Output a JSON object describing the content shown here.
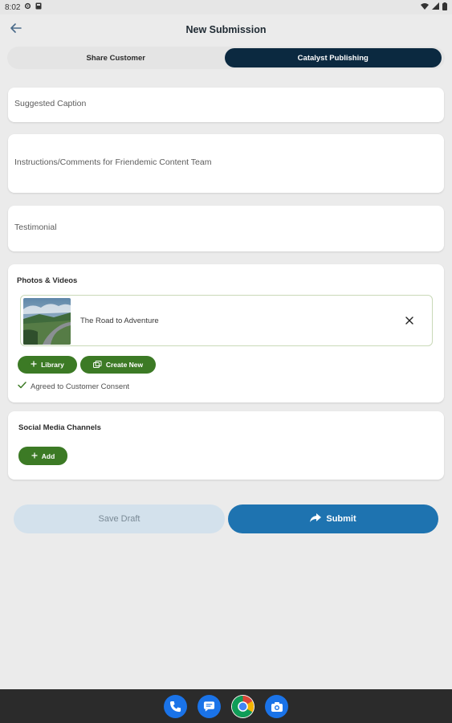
{
  "status_bar": {
    "time": "8:02",
    "icons": [
      "settings-icon",
      "notification-icon",
      "wifi-icon",
      "signal-icon",
      "battery-icon"
    ]
  },
  "app_bar": {
    "title": "New Submission",
    "back_icon": "arrow-left-icon"
  },
  "tabs": [
    {
      "label": "Share Customer",
      "active": false
    },
    {
      "label": "Catalyst Publishing",
      "active": true
    }
  ],
  "fields": {
    "caption_placeholder": "Suggested Caption",
    "instructions_placeholder": "Instructions/Comments for Friendemic Content Team",
    "testimonial_placeholder": "Testimonial"
  },
  "photos_videos": {
    "title": "Photos & Videos",
    "items": [
      {
        "title": "The Road to Adventure"
      }
    ],
    "library_label": "Library",
    "create_new_label": "Create New",
    "consent_text": "Agreed to Customer Consent"
  },
  "social": {
    "title": "Social Media Channels",
    "add_label": "Add"
  },
  "actions": {
    "save_draft_label": "Save Draft",
    "submit_label": "Submit"
  },
  "colors": {
    "accent_dark": "#0b2940",
    "green": "#3c7a25",
    "submit_blue": "#1e73b0",
    "draft_bg": "#d3e1ec"
  },
  "dock": [
    "phone-icon",
    "messages-icon",
    "chrome-icon",
    "camera-icon"
  ]
}
